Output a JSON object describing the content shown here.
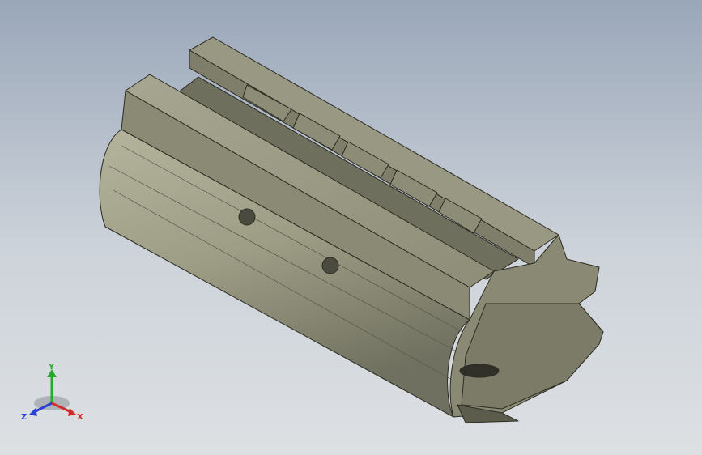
{
  "viewport": {
    "background_top": "#9aa7b9",
    "background_bottom": "#dde0e3"
  },
  "model": {
    "body_color": "#8a8a74",
    "edge_color": "#2b2b22"
  },
  "triad": {
    "x_label": "X",
    "y_label": "Y",
    "z_label": "Z",
    "x_color": "#d42a2a",
    "y_color": "#29a82e",
    "z_color": "#2a3fd4"
  }
}
